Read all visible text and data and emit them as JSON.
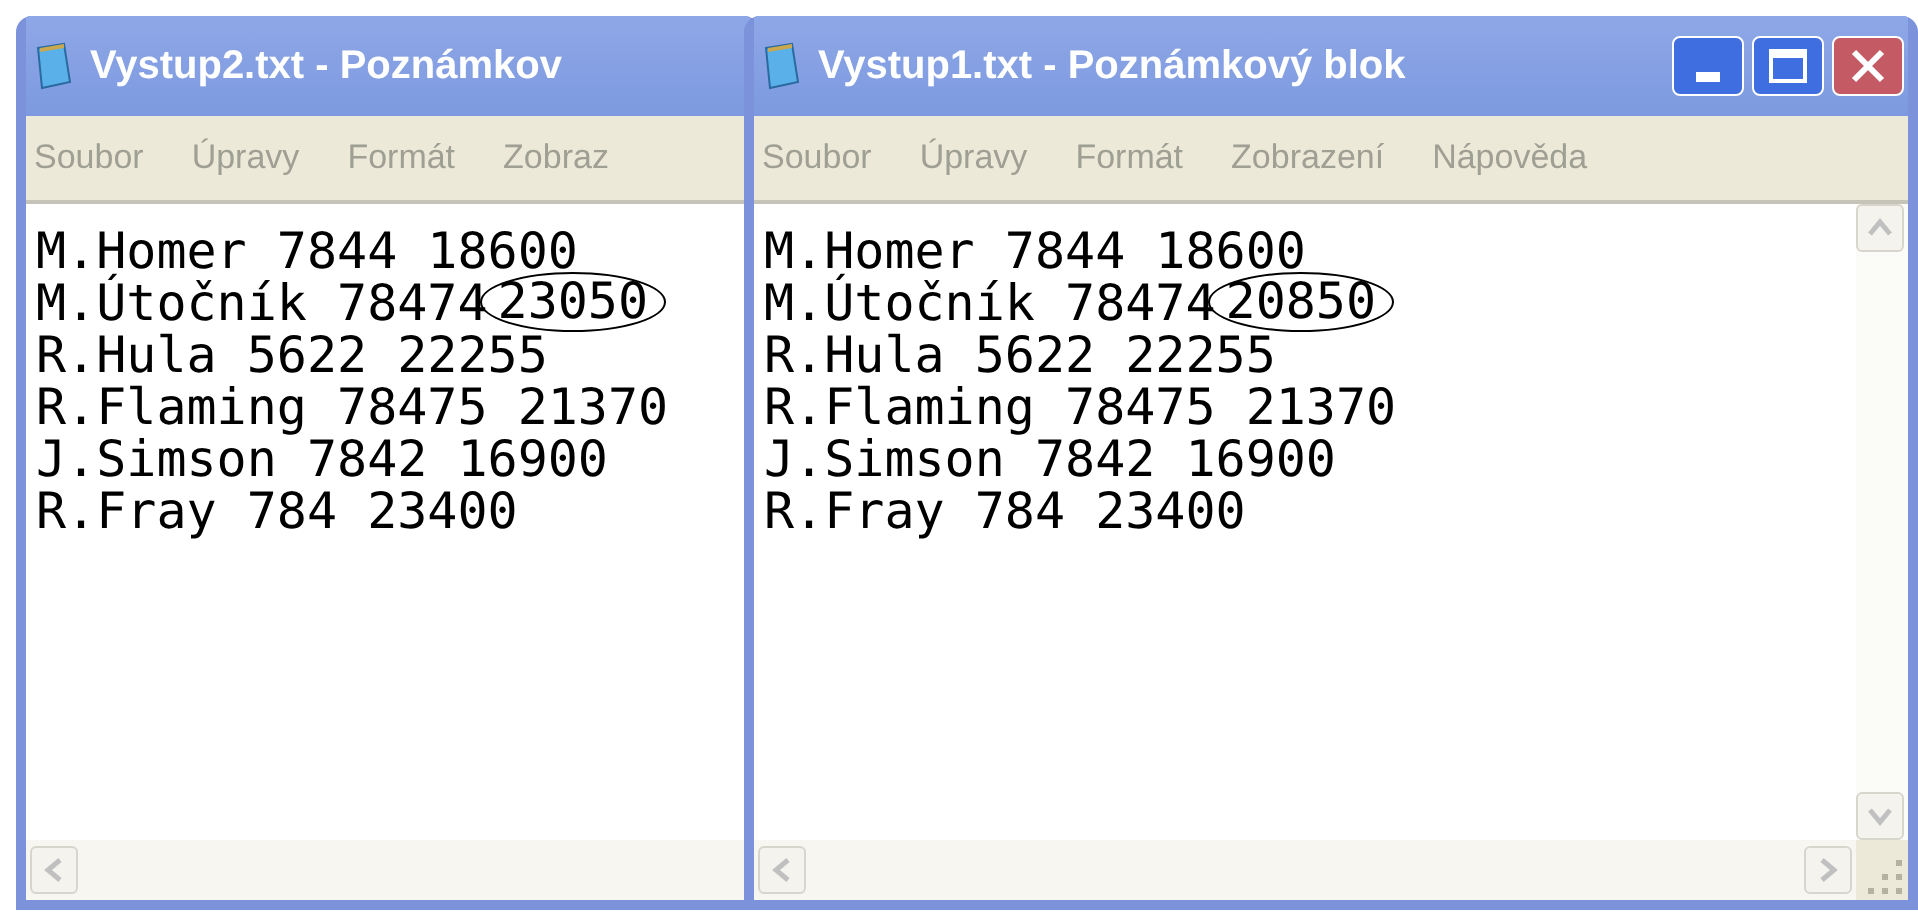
{
  "windows": [
    {
      "title": "Vystup2.txt - Poznámkov",
      "menu": [
        "Soubor",
        "Úpravy",
        "Formát",
        "Zobraz"
      ],
      "front": false,
      "lines": [
        {
          "text": "M.Homer 7844 18600"
        },
        {
          "text": "M.Útočník 78474",
          "circled": "23050"
        },
        {
          "text": "R.Hula 5622 22255"
        },
        {
          "text": "R.Flaming 78475 21370"
        },
        {
          "text": "J.Simson 7842 16900"
        },
        {
          "text": "R.Fray 784 23400"
        }
      ]
    },
    {
      "title": "Vystup1.txt - Poznámkový blok",
      "menu": [
        "Soubor",
        "Úpravy",
        "Formát",
        "Zobrazení",
        "Nápověda"
      ],
      "front": true,
      "lines": [
        {
          "text": "M.Homer 7844 18600"
        },
        {
          "text": "M.Útočník 78474",
          "circled": "20850"
        },
        {
          "text": "R.Hula 5622 22255"
        },
        {
          "text": "R.Flaming 78475 21370"
        },
        {
          "text": "J.Simson 7842 16900"
        },
        {
          "text": "R.Fray 784 23400"
        }
      ]
    }
  ]
}
